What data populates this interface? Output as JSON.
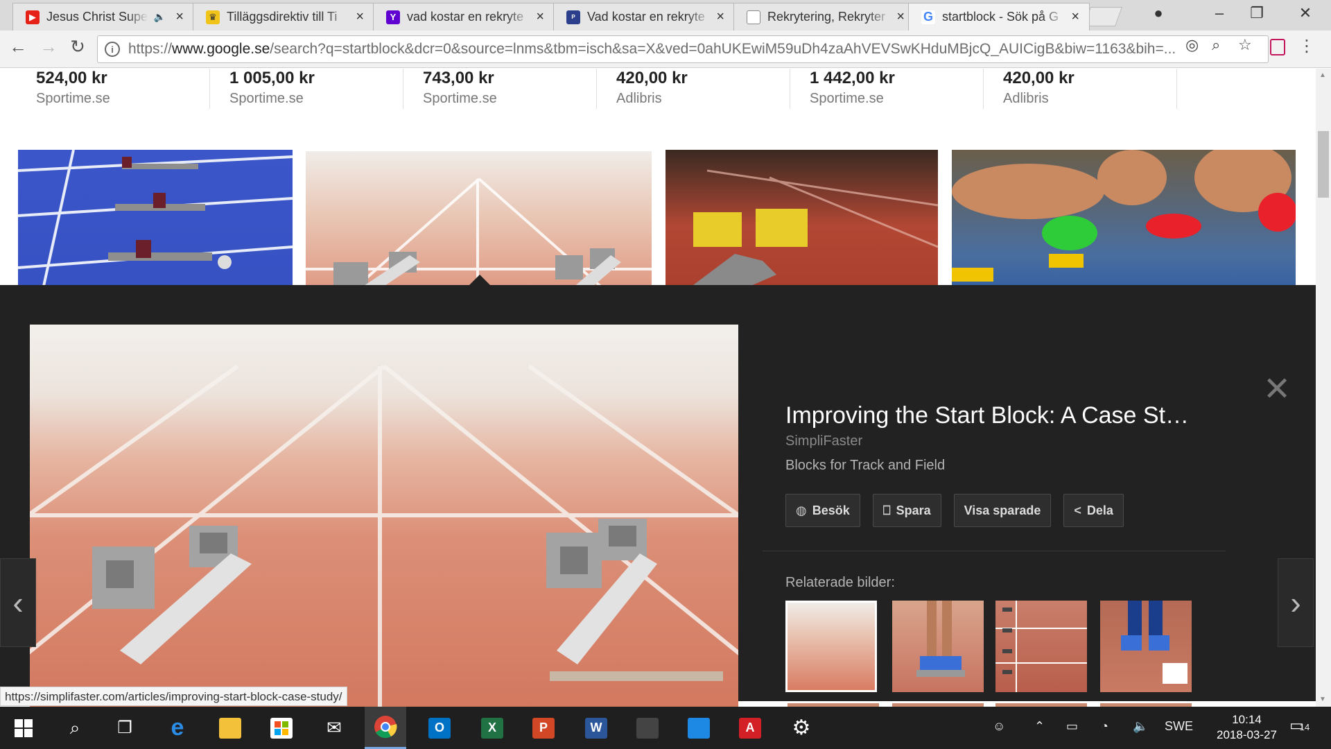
{
  "browser": {
    "tabs": [
      {
        "title": "Jesus Christ Supe",
        "favicon": "youtube-icon",
        "color": "#e62117",
        "muted": true
      },
      {
        "title": "Tilläggsdirektiv till Ti",
        "favicon": "government-crest-icon",
        "color": "#f0c419"
      },
      {
        "title": "vad kostar en rekryte",
        "favicon": "yahoo-icon",
        "color": "#5f01d1"
      },
      {
        "title": "Vad kostar en rekryte",
        "favicon": "news-site-icon",
        "color": "#2b3f8c"
      },
      {
        "title": "Rekrytering, Rekryter",
        "favicon": "document-icon",
        "color": "#999999"
      },
      {
        "title": "startblock - Sök på G",
        "favicon": "google-icon",
        "color": "#4285f4",
        "active": true
      }
    ],
    "tab_close_glyph": "×",
    "url_prefix": "https://",
    "url_host": "www.google.se",
    "url_rest": "/search?q=startblock&dcr=0&source=lnms&tbm=isch&sa=X&ved=0ahUKEwiM59uDh4zaAhVEVSwKHduMBjcQ_AUICigB&biw=1163&bih=..."
  },
  "shopping": [
    {
      "price": "524,00 kr",
      "shop": "Sportime.se"
    },
    {
      "price": "1 005,00 kr",
      "shop": "Sportime.se"
    },
    {
      "price": "743,00 kr",
      "shop": "Sportime.se"
    },
    {
      "price": "420,00 kr",
      "shop": "Adlibris"
    },
    {
      "price": "1 442,00 kr",
      "shop": "Sportime.se"
    },
    {
      "price": "420,00 kr",
      "shop": "Adlibris"
    }
  ],
  "panel": {
    "title": "Improving the Start Block: A Case St…",
    "site": "SimpliFaster",
    "description": "Blocks for Track and Field",
    "buttons": [
      {
        "label": "Besök",
        "icon": "globe-icon"
      },
      {
        "label": "Spara",
        "icon": "bookmark-icon"
      },
      {
        "label": "Visa sparade",
        "icon": ""
      },
      {
        "label": "Dela",
        "icon": "share-icon"
      }
    ],
    "related_label": "Relaterade bilder:",
    "close_glyph": "✕",
    "prev_glyph": "‹",
    "next_glyph": "›"
  },
  "status_url": "https://simplifaster.com/articles/improving-start-block-case-study/",
  "taskbar": {
    "language": "SWE",
    "time": "10:14",
    "date": "2018-03-27",
    "notifications": "14"
  }
}
